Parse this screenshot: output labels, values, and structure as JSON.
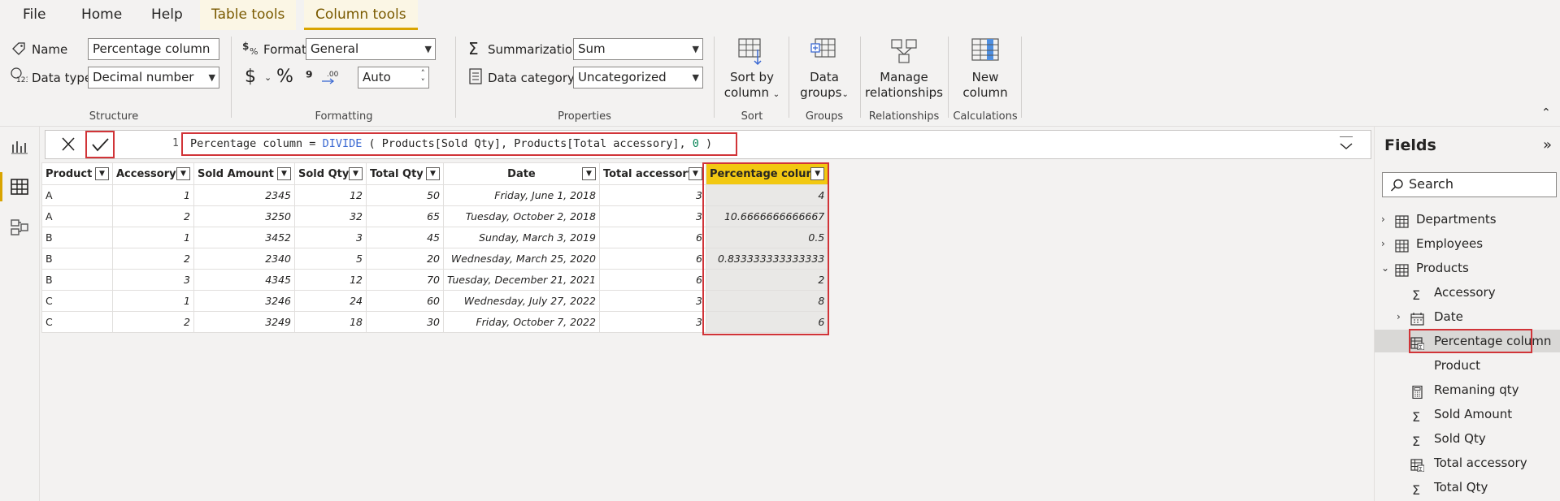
{
  "menu": {
    "tabs": [
      {
        "label": "File"
      },
      {
        "label": "Home"
      },
      {
        "label": "Help"
      },
      {
        "label": "Table tools"
      },
      {
        "label": "Column tools"
      }
    ]
  },
  "ribbon": {
    "structure": {
      "name_label": "Name",
      "name_value": "Percentage column",
      "datatype_label": "Data type",
      "datatype_value": "Decimal number",
      "group_label": "Structure"
    },
    "formatting": {
      "format_label": "Format",
      "format_value": "General",
      "currency_symbol": "$",
      "percent_symbol": "%",
      "comma_symbol": "⁹",
      "decimals_value": "Auto",
      "group_label": "Formatting"
    },
    "properties": {
      "summarization_label": "Summarization",
      "summarization_value": "Sum",
      "datacategory_label": "Data category",
      "datacategory_value": "Uncategorized",
      "group_label": "Properties"
    },
    "sort": {
      "button_line1": "Sort by",
      "button_line2": "column",
      "group_label": "Sort"
    },
    "groups": {
      "button_line1": "Data",
      "button_line2": "groups",
      "group_label": "Groups"
    },
    "relationships": {
      "button_line1": "Manage",
      "button_line2": "relationships",
      "group_label": "Relationships"
    },
    "calculations": {
      "button_line1": "New",
      "button_line2": "column",
      "group_label": "Calculations"
    }
  },
  "formula_bar": {
    "line_number": "1",
    "part1": "Percentage column = ",
    "fn": "DIVIDE",
    "part2": " ( Products[Sold Qty], Products[Total accessory], ",
    "zero": "0",
    "part3": " )"
  },
  "table": {
    "columns": [
      "Product",
      "Accessory",
      "Sold Amount",
      "Sold Qty",
      "Total Qty",
      "Date",
      "Total accessory",
      "Percentage column"
    ],
    "rows": [
      [
        "A",
        "1",
        "2345",
        "12",
        "50",
        "Friday, June 1, 2018",
        "3",
        "4"
      ],
      [
        "A",
        "2",
        "3250",
        "32",
        "65",
        "Tuesday, October 2, 2018",
        "3",
        "10.6666666666667"
      ],
      [
        "B",
        "1",
        "3452",
        "3",
        "45",
        "Sunday, March 3, 2019",
        "6",
        "0.5"
      ],
      [
        "B",
        "2",
        "2340",
        "5",
        "20",
        "Wednesday, March 25, 2020",
        "6",
        "0.833333333333333"
      ],
      [
        "B",
        "3",
        "4345",
        "12",
        "70",
        "Tuesday, December 21, 2021",
        "6",
        "2"
      ],
      [
        "C",
        "1",
        "3246",
        "24",
        "60",
        "Wednesday, July 27, 2022",
        "3",
        "8"
      ],
      [
        "C",
        "2",
        "3249",
        "18",
        "30",
        "Friday, October 7, 2022",
        "3",
        "6"
      ]
    ]
  },
  "fields": {
    "title": "Fields",
    "search_placeholder": "Search",
    "tables": [
      "Departments",
      "Employees",
      "Products"
    ],
    "product_fields": [
      "Accessory",
      "Date",
      "Percentage column",
      "Product",
      "Remaning qty",
      "Sold Amount",
      "Sold Qty",
      "Total accessory",
      "Total Qty"
    ]
  },
  "colors": {
    "accent": "#f2c811",
    "highlight_box": "#d13438",
    "context_tab": "#7a5a00"
  }
}
